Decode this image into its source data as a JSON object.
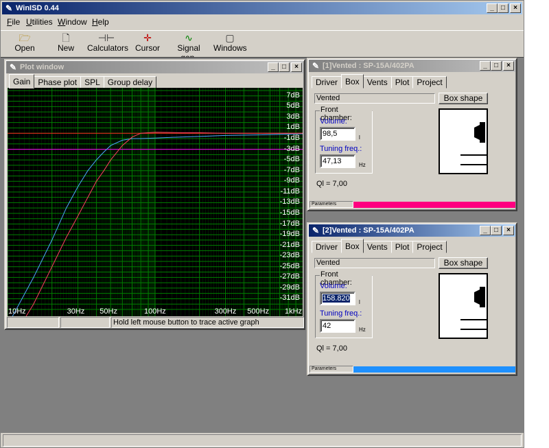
{
  "app": {
    "title": "WinISD 0.44"
  },
  "menu": [
    {
      "label": "File",
      "u": "F",
      "rest": "ile"
    },
    {
      "label": "Utilities",
      "u": "U",
      "rest": "tilities"
    },
    {
      "label": "Window",
      "u": "W",
      "rest": "indow"
    },
    {
      "label": "Help",
      "u": "H",
      "rest": "elp"
    }
  ],
  "toolbar": {
    "open": "Open",
    "new": "New",
    "calculators": "Calculators",
    "cursor": "Cursor",
    "signal_gen": "Signal gen.",
    "windows": "Windows"
  },
  "plot_window": {
    "title": "Plot window",
    "tabs": [
      "Gain",
      "Phase plot",
      "SPL",
      "Group delay"
    ],
    "status_hint": "Hold left mouse button to trace active graph"
  },
  "chart_data": {
    "type": "line",
    "title": "",
    "xlabel": "",
    "ylabel": "",
    "x_scale": "log",
    "xlim": [
      10,
      1000
    ],
    "ylim": [
      -33,
      8
    ],
    "x_ticks": [
      "10Hz",
      "30Hz",
      "50Hz",
      "100Hz",
      "300Hz",
      "500Hz",
      "1kHz"
    ],
    "x_tick_values": [
      10,
      30,
      50,
      100,
      300,
      500,
      1000
    ],
    "y_ticks": [
      "7dB",
      "5dB",
      "3dB",
      "1dB",
      "-1dB",
      "-3dB",
      "-5dB",
      "-7dB",
      "-9dB",
      "-11dB",
      "-13dB",
      "-15dB",
      "-17dB",
      "-19dB",
      "-21dB",
      "-23dB",
      "-25dB",
      "-27dB",
      "-29dB",
      "-31dB"
    ],
    "y_tick_values": [
      7,
      5,
      3,
      1,
      -1,
      -3,
      -5,
      -7,
      -9,
      -11,
      -13,
      -15,
      -17,
      -19,
      -21,
      -23,
      -25,
      -27,
      -29,
      -31
    ],
    "reference_lines": [
      {
        "y": 0,
        "color": "#ff2020"
      },
      {
        "y": -3,
        "color": "#ff00ff"
      }
    ],
    "grid": true,
    "series": [
      {
        "color": "#4da6ff",
        "x": [
          10,
          15,
          20,
          25,
          30,
          35,
          40,
          45,
          50,
          60,
          70,
          80,
          100,
          150,
          200,
          300,
          500,
          1000
        ],
        "y": [
          -36,
          -27,
          -20,
          -14,
          -10,
          -7,
          -5,
          -3.5,
          -2.3,
          -1.3,
          -1.0,
          -1.0,
          -0.9,
          -0.7,
          -0.6,
          -0.4,
          -0.3,
          -0.1
        ]
      },
      {
        "color": "#ff4060",
        "x": [
          10,
          15,
          20,
          25,
          30,
          35,
          40,
          45,
          50,
          60,
          70,
          80,
          100,
          150,
          200,
          300,
          500,
          1000
        ],
        "y": [
          -40,
          -32,
          -25,
          -19.5,
          -15.5,
          -12,
          -9,
          -7,
          -5,
          -2.3,
          -0.7,
          0,
          0.2,
          0.1,
          0.1,
          0,
          0,
          0
        ]
      }
    ]
  },
  "box1": {
    "title": "[1]Vented : SP-15A/402PA",
    "tabs": [
      "Driver",
      "Box",
      "Vents",
      "Plot",
      "Project"
    ],
    "box_type": "Vented",
    "box_shape_btn": "Box shape",
    "front_chamber": "Front chamber:",
    "volume_label": "Volume:",
    "volume_value": "98,5",
    "volume_unit": "l",
    "tuning_label": "Tuning freq.:",
    "tuning_value": "47,13",
    "tuning_unit": "Hz",
    "ql": "Ql = 7,00",
    "params_label": "Parameters",
    "color": "#ff0080"
  },
  "box2": {
    "title": "[2]Vented : SP-15A/402PA",
    "tabs": [
      "Driver",
      "Box",
      "Vents",
      "Plot",
      "Project"
    ],
    "box_type": "Vented",
    "box_shape_btn": "Box shape",
    "front_chamber": "Front chamber:",
    "volume_label": "Volume:",
    "volume_value": "158.820",
    "volume_unit": "l",
    "tuning_label": "Tuning freq.:",
    "tuning_value": "42",
    "tuning_unit": "Hz",
    "ql": "Ql = 7,00",
    "params_label": "Parameters",
    "color": "#1e90ff"
  }
}
